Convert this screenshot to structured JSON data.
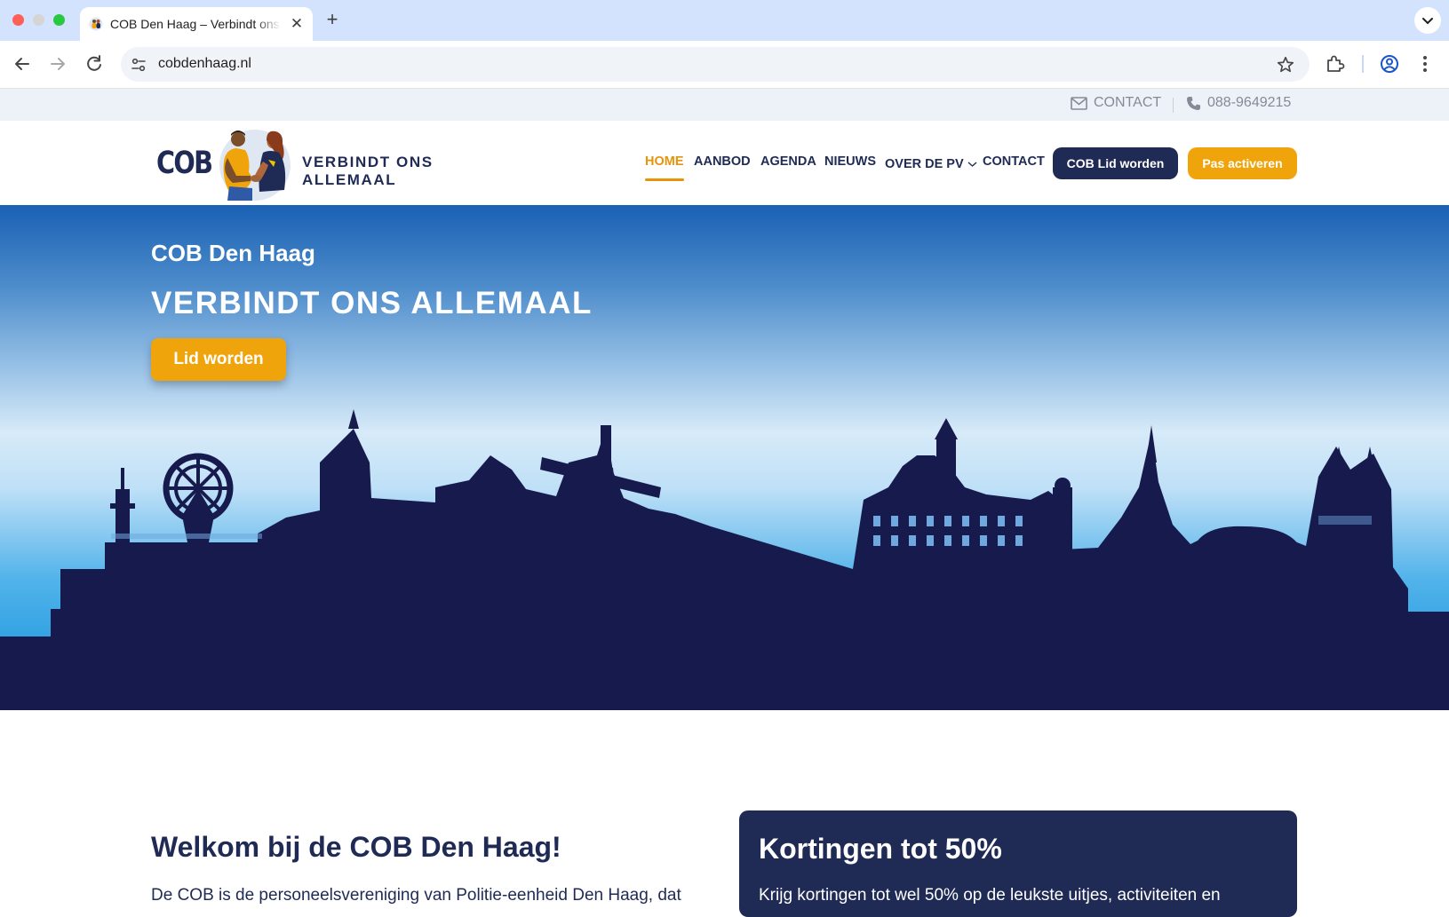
{
  "browser": {
    "tab_title": "COB Den Haag – Verbindt ons allemaal",
    "url": "cobdenhaag.nl",
    "new_tab": "+",
    "close_tab": "✕"
  },
  "topbar": {
    "contact_label": "CONTACT",
    "phone": "088-9649215"
  },
  "header": {
    "logo_text": "COB",
    "logo_tagline": "VERBINDT ONS ALLEMAAL",
    "nav": [
      "HOME",
      "AANBOD",
      "AGENDA",
      "NIEUWS",
      "OVER DE PV",
      "CONTACT"
    ],
    "active_item": "HOME",
    "member_button": "COB Lid worden",
    "activate_button": "Pas activeren"
  },
  "hero": {
    "subtitle": "COB Den Haag",
    "title": "VERBINDT ONS ALLEMAAL",
    "cta": "Lid worden"
  },
  "welcome": {
    "title": "Welkom bij de COB Den Haag!",
    "text": "De COB is de personeelsvereniging van Politie-eenheid Den Haag, dat"
  },
  "discount_card": {
    "title": "Kortingen tot 50%",
    "text": "Krijg kortingen tot wel 50% op de leukste uitjes, activiteiten en"
  },
  "colors": {
    "navy": "#1f2a55",
    "accent_orange": "#f0a40c",
    "active_nav": "#e8930c"
  }
}
